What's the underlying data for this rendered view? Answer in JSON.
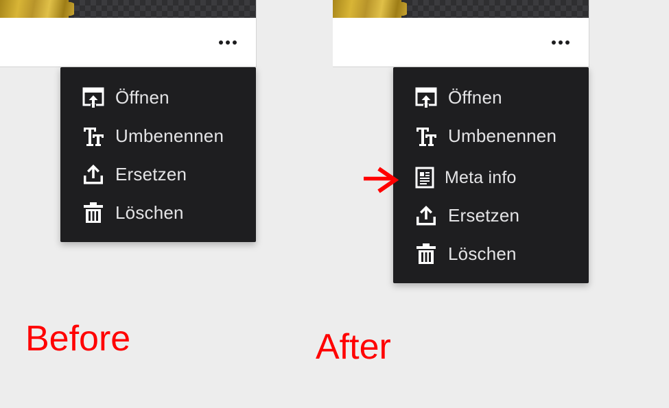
{
  "before": {
    "caption": "Before",
    "menu_items": [
      {
        "label": "Öffnen",
        "icon": "open-icon"
      },
      {
        "label": "Umbenennen",
        "icon": "rename-text-icon"
      },
      {
        "label": "Ersetzen",
        "icon": "upload-icon"
      },
      {
        "label": "Löschen",
        "icon": "trash-icon"
      }
    ]
  },
  "after": {
    "caption": "After",
    "menu_items": [
      {
        "label": "Öffnen",
        "icon": "open-icon"
      },
      {
        "label": "Umbenennen",
        "icon": "rename-text-icon"
      },
      {
        "label": "Meta info",
        "icon": "document-icon"
      },
      {
        "label": "Ersetzen",
        "icon": "upload-icon"
      },
      {
        "label": "Löschen",
        "icon": "trash-icon"
      }
    ],
    "highlight_indicator": "arrow-right-icon"
  },
  "colors": {
    "menu_background": "#1e1e20",
    "menu_text": "#e4e4e6",
    "caption": "#ff0000",
    "page_background": "#ededed",
    "arrow": "#ff0000"
  }
}
